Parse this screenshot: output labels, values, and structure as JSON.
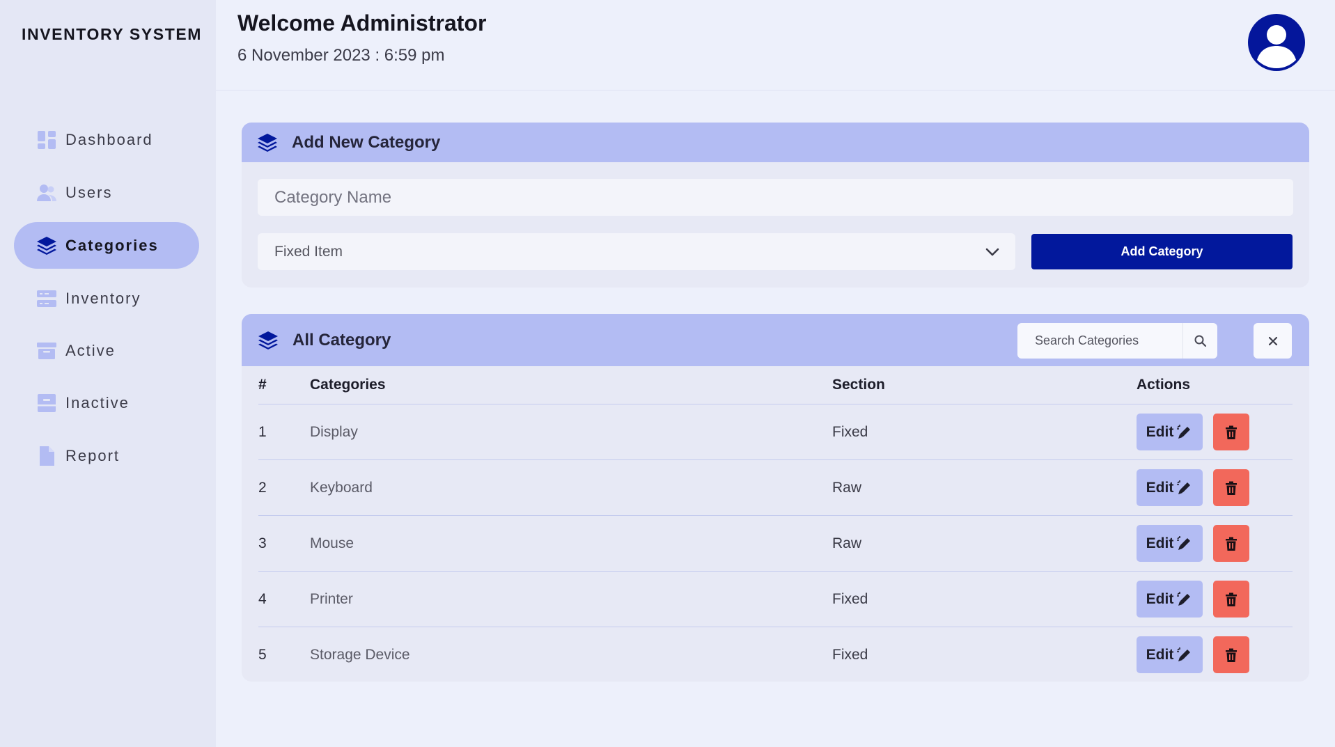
{
  "app": {
    "brand": "INVENTORY SYSTEM"
  },
  "sidebar": {
    "items": [
      {
        "label": "Dashboard",
        "icon": "dashboard-icon",
        "active": false
      },
      {
        "label": "Users",
        "icon": "users-icon",
        "active": false
      },
      {
        "label": "Categories",
        "icon": "layers-icon",
        "active": true
      },
      {
        "label": "Inventory",
        "icon": "server-icon",
        "active": false
      },
      {
        "label": "Active",
        "icon": "archive-icon",
        "active": false
      },
      {
        "label": "Inactive",
        "icon": "archive-minus-icon",
        "active": false
      },
      {
        "label": "Report",
        "icon": "file-icon",
        "active": false
      }
    ]
  },
  "header": {
    "welcome": "Welcome Administrator",
    "datetime": "6 November 2023 : 6:59 pm",
    "avatar_icon": "user-avatar-icon"
  },
  "add_category": {
    "title": "Add New Category",
    "name_placeholder": "Category Name",
    "section_selected": "Fixed Item",
    "submit_label": "Add Category"
  },
  "all_category": {
    "title": "All Category",
    "search_placeholder": "Search Categories",
    "columns": [
      "#",
      "Categories",
      "Section",
      "Actions"
    ],
    "rows": [
      {
        "num": "1",
        "category": "Display",
        "section": "Fixed"
      },
      {
        "num": "2",
        "category": "Keyboard",
        "section": "Raw"
      },
      {
        "num": "3",
        "category": "Mouse",
        "section": "Raw"
      },
      {
        "num": "4",
        "category": "Printer",
        "section": "Fixed"
      },
      {
        "num": "5",
        "category": "Storage Device",
        "section": "Fixed"
      }
    ],
    "edit_label": "Edit"
  },
  "colors": {
    "accent": "#02189c",
    "header_band": "#b3bcf3",
    "delete": "#f2685b",
    "sidebar_bg": "#e4e7f5",
    "page_bg": "#edf0fb"
  }
}
